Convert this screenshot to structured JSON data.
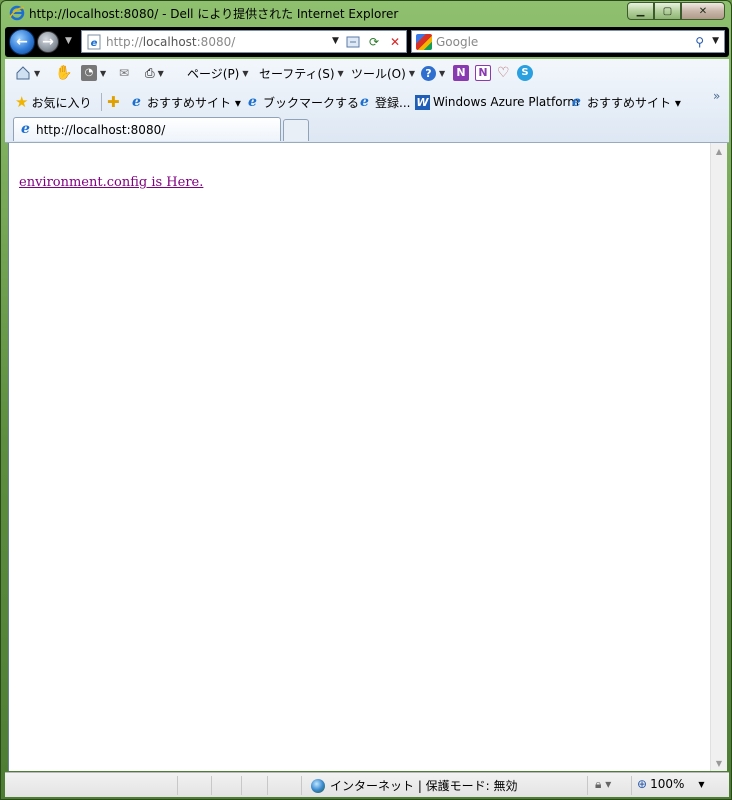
{
  "window": {
    "title": "http://localhost:8080/ - Dell により提供された Internet Explorer"
  },
  "address": {
    "url_prefix": "http://",
    "url_host": "localhost",
    "url_suffix": ":8080/"
  },
  "search": {
    "placeholder": "Google"
  },
  "command_bar": {
    "page_label": "ページ(P)",
    "safety_label": "セーフティ(S)",
    "tools_label": "ツール(O)"
  },
  "favorites_bar": {
    "favorites_label": "お気に入り",
    "items": [
      {
        "label": "おすすめサイト ▾"
      },
      {
        "label": "ブックマークする"
      },
      {
        "label": "登録..."
      },
      {
        "label": "Windows Azure Platform"
      },
      {
        "label": "おすすめサイト ▾"
      }
    ],
    "chevron": "»"
  },
  "tabs": [
    {
      "label": "http://localhost:8080/"
    }
  ],
  "content": {
    "link_text": "environment.config is Here."
  },
  "status_bar": {
    "zone_text": "インターネット | 保護モード: 無効",
    "zoom_text": "100%"
  },
  "colors": {
    "link_visited": "#800080",
    "frame": "#5d8e3f"
  }
}
